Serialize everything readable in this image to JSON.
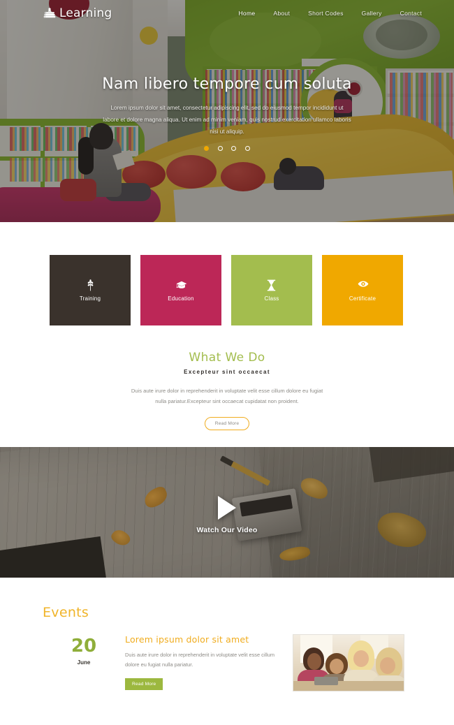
{
  "brand": {
    "name": "Learning",
    "icon": "books-icon"
  },
  "nav": {
    "items": [
      {
        "label": "Home",
        "active": true
      },
      {
        "label": "About",
        "active": false
      },
      {
        "label": "Short Codes",
        "active": false
      },
      {
        "label": "Gallery",
        "active": false
      },
      {
        "label": "Contact",
        "active": false
      }
    ]
  },
  "hero": {
    "title": "Nam libero tempore cum soluta",
    "text": "Lorem ipsum dolor sit amet, consectetur adipiscing elit, sed do eiusmod tempor incididunt ut labore et dolore magna aliqua. Ut enim ad minim veniam, quis nostrud exercitation ullamco laboris nisi ut aliquip.",
    "slider": {
      "total": 4,
      "active_index": 0,
      "active_color": "#f0a800"
    },
    "image_alt": "library-interior-photo"
  },
  "services": [
    {
      "label": "Training",
      "icon": "wheat-plant-icon",
      "color": "#3a322c"
    },
    {
      "label": "Education",
      "icon": "graduation-cap-icon",
      "color": "#bc2757"
    },
    {
      "label": "Class",
      "icon": "hourglass-icon",
      "color": "#a3bd4e"
    },
    {
      "label": "Certificate",
      "icon": "eye-icon",
      "color": "#f0a800"
    }
  ],
  "what_we_do": {
    "title": "What We Do",
    "title_color": "#a3bd4e",
    "subtitle": "Excepteur sint occaecat",
    "text": "Duis aute irure dolor in reprehenderit in voluptate velit esse cillum dolore eu fugiat nulla pariatur.Excepteur sint occaecat cupidatat non proident.",
    "button": "Read More",
    "button_border_color": "#f0ac1e"
  },
  "video": {
    "label": "Watch Our Video",
    "play_icon": "play-triangle-icon",
    "image_alt": "pencil-shavings-notebook-photo"
  },
  "events": {
    "title": "Events",
    "title_color": "#f0b429",
    "items": [
      {
        "day": "20",
        "day_color": "#8fae3a",
        "month": "June",
        "title": "Lorem ipsum dolor sit amet",
        "title_color": "#f0ac1e",
        "text": "Duis aute irure dolor in reprehenderit in voluptate velit esse cillum dolore eu fugiat nulla pariatur.",
        "button": "Read More",
        "button_color": "#9cb83f",
        "image_alt": "students-studying-photo"
      }
    ]
  }
}
